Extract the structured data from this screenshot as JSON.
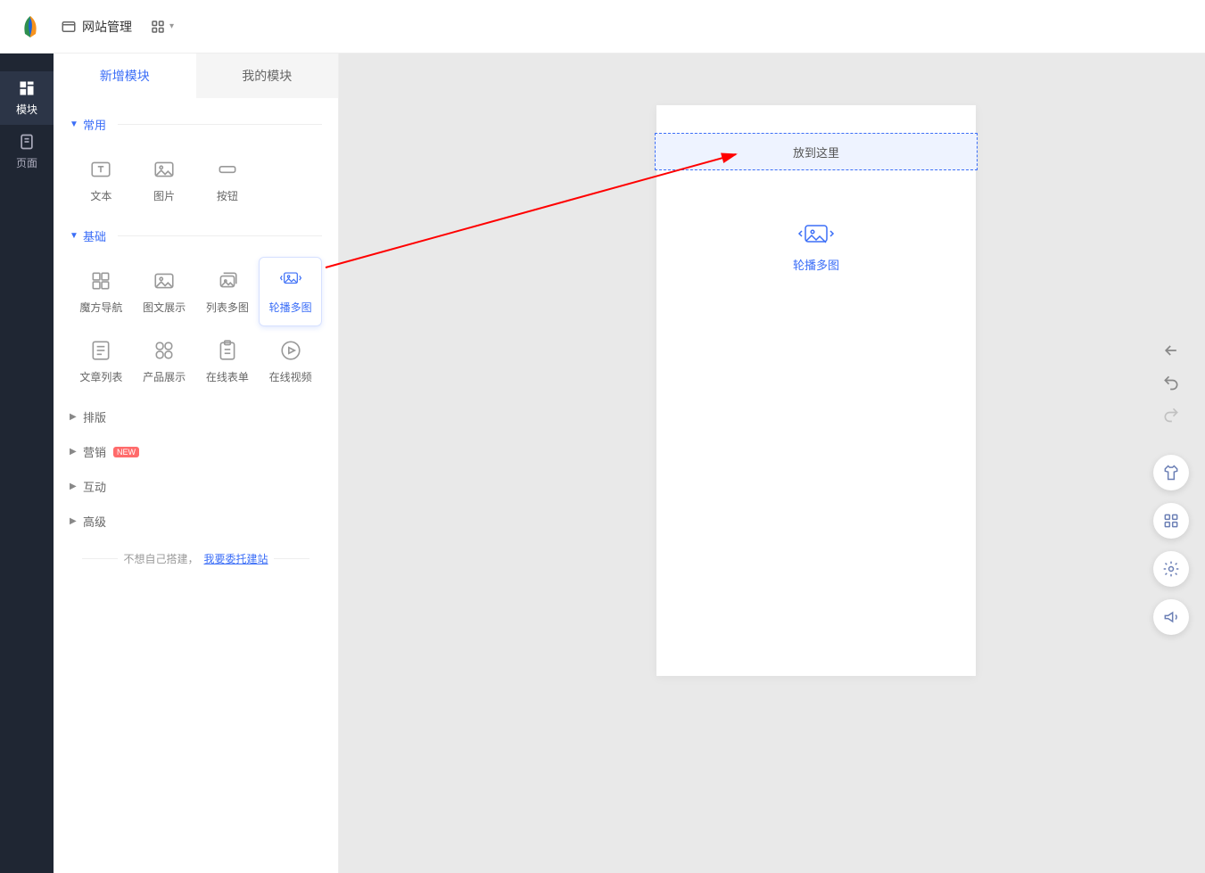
{
  "topbar": {
    "site_mgmt": "网站管理"
  },
  "rail": {
    "modules": "模块",
    "pages": "页面"
  },
  "tabs": {
    "add_module": "新增模块",
    "my_modules": "我的模块"
  },
  "sections": {
    "common": "常用",
    "basic": "基础",
    "layout": "排版",
    "marketing": "营销",
    "interactive": "互动",
    "advanced": "高级",
    "new_badge": "NEW"
  },
  "modules_common": {
    "text": "文本",
    "image": "图片",
    "button": "按钮"
  },
  "modules_basic": {
    "cube_nav": "魔方导航",
    "image_text": "图文展示",
    "list_multi": "列表多图",
    "carousel": "轮播多图",
    "article_list": "文章列表",
    "product_show": "产品展示",
    "online_form": "在线表单",
    "online_video": "在线视频"
  },
  "footer": {
    "prefix": "不想自己搭建，",
    "link": "我要委托建站"
  },
  "canvas": {
    "drop_here": "放到这里",
    "placeholder_label": "轮播多图"
  }
}
